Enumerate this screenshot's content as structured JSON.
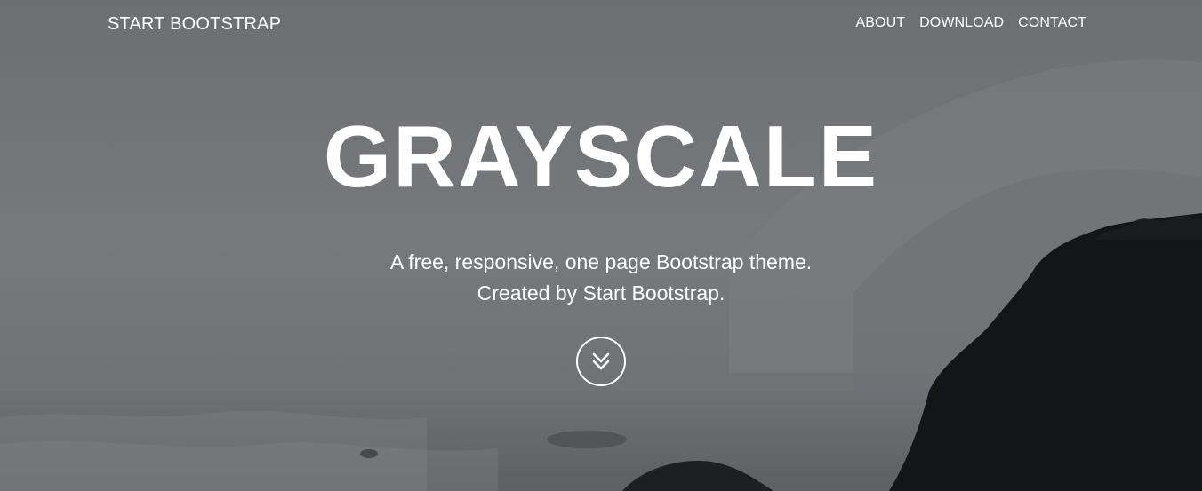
{
  "navbar": {
    "brand": "START BOOTSTRAP",
    "links": [
      {
        "label": "ABOUT"
      },
      {
        "label": "DOWNLOAD"
      },
      {
        "label": "CONTACT"
      }
    ]
  },
  "hero": {
    "title": "GRAYSCALE",
    "subtitle_line1": "A free, responsive, one page Bootstrap theme.",
    "subtitle_line2": "Created by Start Bootstrap.",
    "scroll_icon": "double-chevron-down-icon"
  },
  "colors": {
    "text": "#ffffff",
    "background": "#6f7275",
    "cliff": "#141516"
  }
}
